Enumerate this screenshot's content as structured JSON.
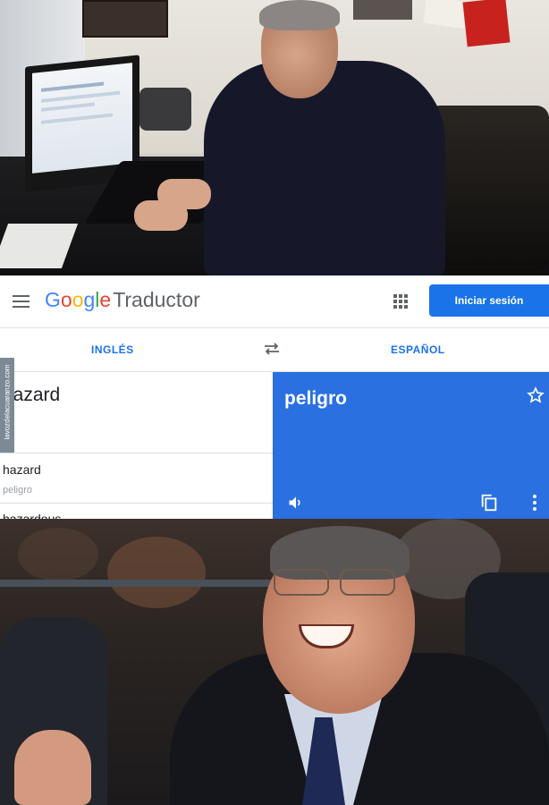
{
  "photo_top": {
    "alt": ""
  },
  "header": {
    "logo_letters": [
      {
        "char": "G",
        "color": "#4285F4"
      },
      {
        "char": "o",
        "color": "#EA4335"
      },
      {
        "char": "o",
        "color": "#FBBC05"
      },
      {
        "char": "g",
        "color": "#4285F4"
      },
      {
        "char": "l",
        "color": "#34A853"
      },
      {
        "char": "e",
        "color": "#EA4335"
      }
    ],
    "product_name": "Traductor",
    "signin_label": "Iniciar sesión",
    "menu_icon": "hamburger-menu-icon",
    "apps_icon": "apps-grid-icon"
  },
  "language_bar": {
    "source_language": "INGLÉS",
    "target_language": "ESPAÑOL",
    "swap_icon": "swap-arrows-icon"
  },
  "source": {
    "text": "hazard",
    "suggestions": [
      {
        "word": "hazard",
        "translation": "peligro"
      },
      {
        "word": "hazardous",
        "translation": ""
      }
    ]
  },
  "target": {
    "text": "peligro",
    "icons": [
      "star-icon",
      "speaker-icon",
      "copy-icon",
      "more-vert-icon"
    ]
  },
  "watermark": {
    "text": "lavozdelacuaranzo.com"
  },
  "colors": {
    "accent": "#1a73e8",
    "target_background": "#2a70e0",
    "header_text": "#5f6368"
  }
}
